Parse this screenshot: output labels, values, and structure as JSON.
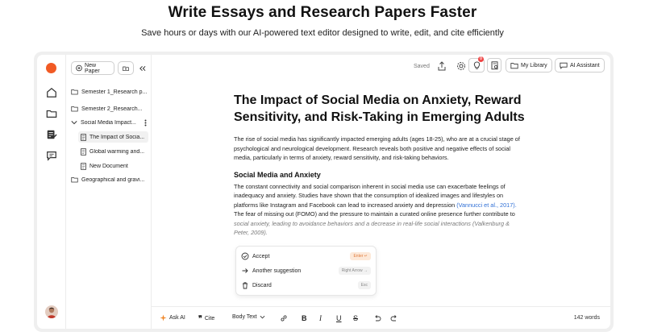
{
  "hero": {
    "title": "Write Essays and Research Papers Faster",
    "subtitle": "Save hours or days with our AI-powered text editor designed to write, edit, and cite efficiently"
  },
  "sidebar": {
    "new_paper": "New Paper",
    "items": [
      {
        "label": "Semester 1_Research p...",
        "type": "folder"
      },
      {
        "label": "Semester 2_Research...",
        "type": "folder"
      },
      {
        "label": "Social Media Impact...",
        "type": "folder-open"
      },
      {
        "label": "The Impact of Socia...",
        "type": "doc"
      },
      {
        "label": "Global warming and...",
        "type": "doc"
      },
      {
        "label": "New Document",
        "type": "doc"
      },
      {
        "label": "Geographical and gravi...",
        "type": "folder"
      }
    ]
  },
  "toolbar": {
    "saved": "Saved",
    "notif_count": "0",
    "my_library": "My Library",
    "ai_assistant": "AI Assistant"
  },
  "doc": {
    "title": "The Impact of Social Media on Anxiety, Reward Sensitivity, and Risk-Taking in Emerging Adults",
    "intro": "The rise of social media has significantly impacted emerging adults (ages 18-25), who are at a crucial stage of psychological and neurological development. Research reveals both positive and negative effects of social media, particularly in terms of anxiety, reward sensitivity, and risk-taking behaviors.",
    "section_heading": "Social Media and Anxiety",
    "section_text_1": "The constant connectivity and social comparison inherent in social media use can exacerbate feelings of inadequacy and anxiety. Studies have shown that the consumption of idealized images and lifestyles on platforms like Instagram and Facebook can lead to increased anxiety and depression ",
    "citation": "(Vannucci et al., 2017).",
    "section_text_2": " The fear of missing out (FOMO) and the pressure to maintain a curated online presence further contribute to ",
    "suggestion": "social anxiety, leading to avoidance behaviors and a decrease in real-life social interactions (Valkenburg & Peter, 2009)."
  },
  "popup": {
    "accept": "Accept",
    "accept_key": "Enter ↵",
    "another": "Another suggestion",
    "another_key": "Right Arrow →",
    "discard": "Discard",
    "discard_key": "Esc"
  },
  "bottom": {
    "ask_ai": "Ask AI",
    "cite": "Cite",
    "style": "Body Text",
    "word_count": "142 words"
  }
}
